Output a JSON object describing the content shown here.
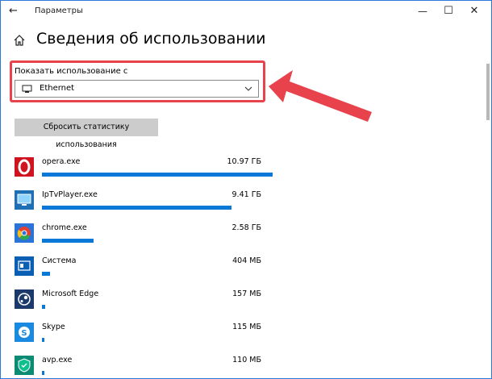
{
  "window": {
    "title": "Параметры",
    "back_icon": "back-arrow-icon",
    "controls": {
      "minimize": "—",
      "maximize": "☐",
      "close": "✕"
    }
  },
  "page": {
    "title": "Сведения об использовании",
    "home_icon": "home-icon"
  },
  "filter": {
    "label": "Показать использование с",
    "selected": "Ethernet",
    "icon": "network-icon"
  },
  "reset_button": {
    "label": "Сбросить статистику использования"
  },
  "apps": [
    {
      "name": "opera.exe",
      "size": "10.97 ГБ",
      "usage": 1.0,
      "icon": "opera-icon",
      "color": "#d0141f"
    },
    {
      "name": "IpTvPlayer.exe",
      "size": "9.41 ГБ",
      "usage": 0.82,
      "icon": "tv-icon",
      "color": "#1f6fb5"
    },
    {
      "name": "chrome.exe",
      "size": "2.58 ГБ",
      "usage": 0.225,
      "icon": "chrome-icon",
      "color": "#2a73d9"
    },
    {
      "name": "Система",
      "size": "404 МБ",
      "usage": 0.035,
      "icon": "system-icon",
      "color": "#0a5fb4"
    },
    {
      "name": "Microsoft Edge",
      "size": "157 МБ",
      "usage": 0.014,
      "icon": "steam-icon",
      "color": "#1b3a6b"
    },
    {
      "name": "Skype",
      "size": "115 МБ",
      "usage": 0.012,
      "icon": "skype-icon",
      "color": "#1a8ae0"
    },
    {
      "name": "avp.exe",
      "size": "110 МБ",
      "usage": 0.011,
      "icon": "kaspersky-icon",
      "color": "#0b8a74"
    }
  ],
  "colors": {
    "accent": "#0a78d7",
    "highlight": "#e8434c",
    "button": "#cccccc"
  }
}
